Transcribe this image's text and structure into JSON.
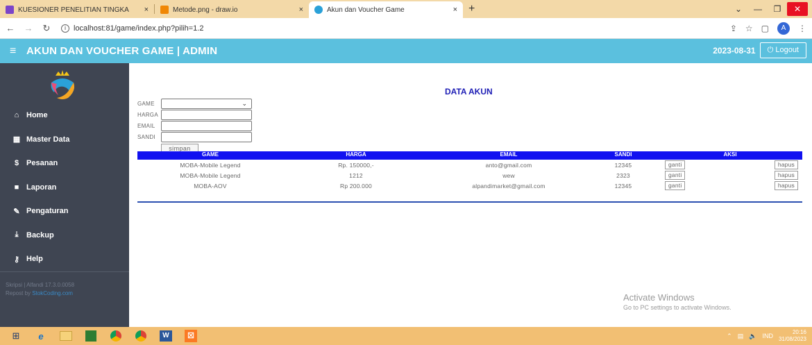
{
  "browser": {
    "tabs": [
      {
        "title": "KUESIONER PENELITIAN TINGKA",
        "close": "×",
        "color": "#7b45c9"
      },
      {
        "title": "Metode.png - draw.io",
        "close": "×",
        "color": "#f08705"
      },
      {
        "title": "Akun dan Voucher Game",
        "close": "×",
        "color": "#2aa1d8"
      }
    ],
    "new_tab": "+",
    "url": "localhost:81/game/index.php?pilih=1.2",
    "profile_initial": "A"
  },
  "app": {
    "title": "AKUN DAN VOUCHER GAME | ADMIN",
    "date": "2023-08-31",
    "logout_label": "Logout",
    "accent": "#5bc0de",
    "sidebar_bg": "#3f4552"
  },
  "sidebar": {
    "items": [
      {
        "label": "Home",
        "icon": "home-icon",
        "glyph": "⌂"
      },
      {
        "label": "Master Data",
        "icon": "grid-icon",
        "glyph": "▦"
      },
      {
        "label": "Pesanan",
        "icon": "dollar-icon",
        "glyph": "$"
      },
      {
        "label": "Laporan",
        "icon": "report-icon",
        "glyph": "■"
      },
      {
        "label": "Pengaturan",
        "icon": "wrench-icon",
        "glyph": "✎"
      },
      {
        "label": "Backup",
        "icon": "download-icon",
        "glyph": "⤓"
      },
      {
        "label": "Help",
        "icon": "key-icon",
        "glyph": "⚷"
      }
    ],
    "footer_line1": "Skripsi | Alfandi 17.3.0.0058",
    "footer_line2_prefix": "Repost by",
    "footer_line2_link": "StokCoding.com"
  },
  "main": {
    "title": "DATA AKUN",
    "form": {
      "game_label": "GAME",
      "harga_label": "HARGA",
      "email_label": "EMAIL",
      "sandi_label": "SANDI",
      "submit_label": "simpan"
    },
    "table": {
      "headers": [
        "GAME",
        "HARGA",
        "EMAIL",
        "SANDI",
        "AKSI"
      ],
      "rows": [
        [
          "MOBA-Mobile Legend",
          "Rp. 150000,-",
          "anto@gmail.com",
          "12345"
        ],
        [
          "MOBA-Mobile Legend",
          "1212",
          "wew",
          "2323"
        ],
        [
          "MOBA-AOV",
          "Rp 200.000",
          "alpandimarket@gmail.com",
          "12345"
        ]
      ],
      "edit_label": "ganti",
      "delete_label": "hapus"
    }
  },
  "watermark": {
    "line1": "Activate Windows",
    "line2": "Go to PC settings to activate Windows."
  },
  "taskbar": {
    "lang": "IND",
    "time": "20:16",
    "date": "31/08/2023"
  }
}
